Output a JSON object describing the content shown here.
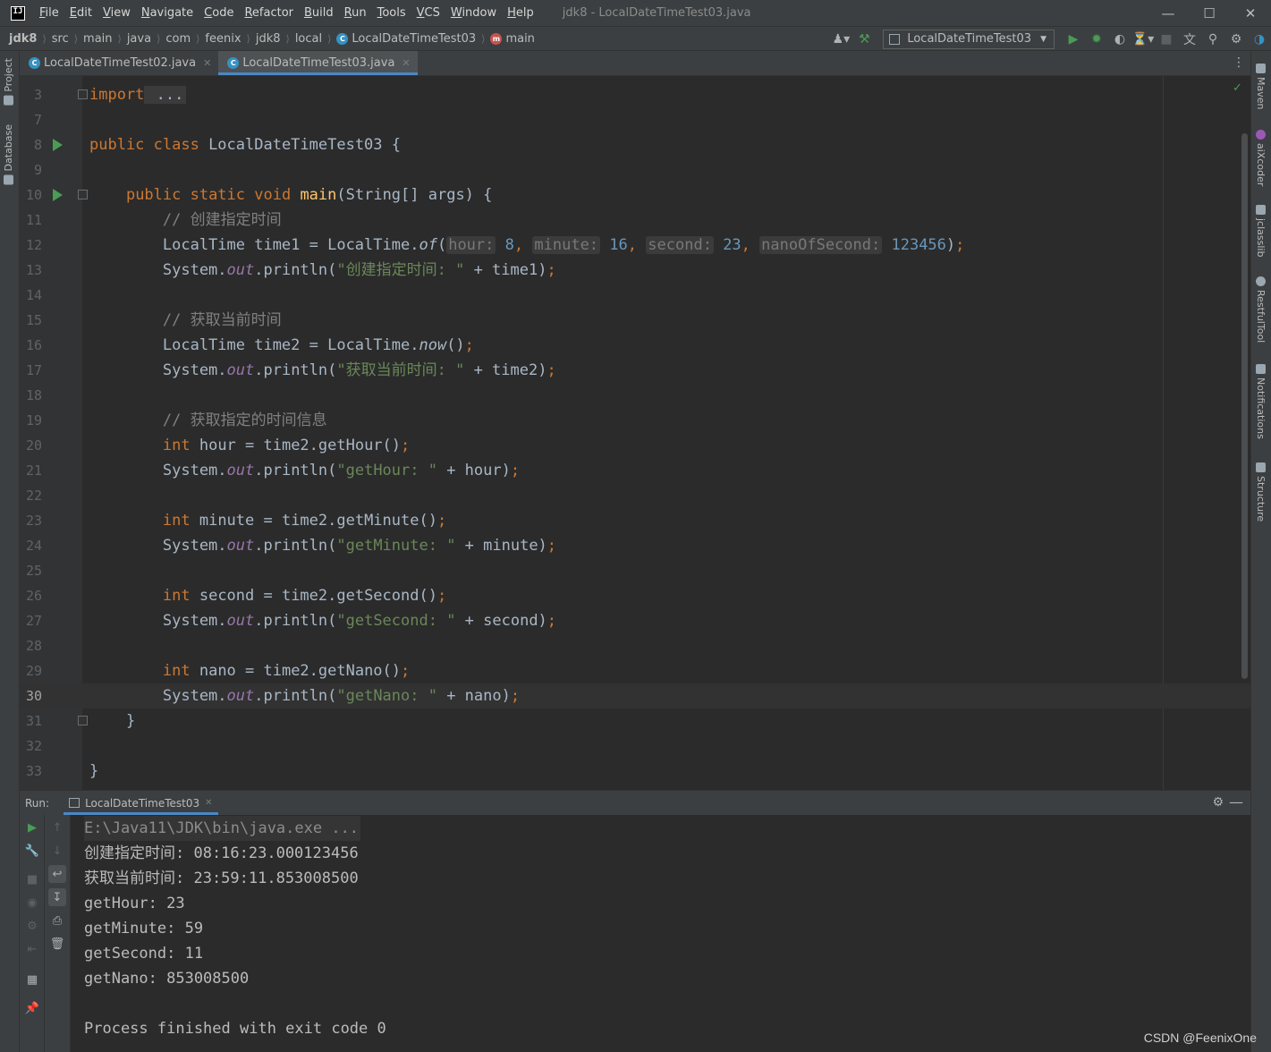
{
  "window": {
    "title": "jdk8 - LocalDateTimeTest03.java",
    "menu": [
      "File",
      "Edit",
      "View",
      "Navigate",
      "Code",
      "Refactor",
      "Build",
      "Run",
      "Tools",
      "VCS",
      "Window",
      "Help"
    ]
  },
  "breadcrumb": [
    "jdk8",
    "src",
    "main",
    "java",
    "com",
    "feenix",
    "jdk8",
    "local",
    "LocalDateTimeTest03",
    "main"
  ],
  "run_config": {
    "label": "LocalDateTimeTest03"
  },
  "tabs": [
    {
      "label": "LocalDateTimeTest02.java",
      "active": false
    },
    {
      "label": "LocalDateTimeTest03.java",
      "active": true
    }
  ],
  "left_tool_windows": [
    "Project",
    "Database"
  ],
  "right_tool_windows": [
    "Maven",
    "aiXcoder",
    "jclasslib",
    "RestfulTool",
    "Notifications",
    "Structure"
  ],
  "editor": {
    "lines": [
      {
        "n": "3",
        "parts": [
          [
            "kw",
            "import"
          ],
          [
            "",
            ""
          ],
          [
            "fold",
            " ..."
          ]
        ],
        "fold": true
      },
      {
        "n": "7",
        "parts": []
      },
      {
        "n": "8",
        "run": true,
        "parts": [
          [
            "kw",
            "public class"
          ],
          [
            "",
            " LocalDateTimeTest03 {"
          ]
        ]
      },
      {
        "n": "9",
        "parts": []
      },
      {
        "n": "10",
        "run": true,
        "fold": true,
        "parts": [
          [
            "",
            "    "
          ],
          [
            "kw",
            "public static void"
          ],
          [
            "",
            " "
          ],
          [
            "fn",
            "main"
          ],
          [
            "",
            "(String[] args) {"
          ]
        ]
      },
      {
        "n": "11",
        "parts": [
          [
            "",
            "        "
          ],
          [
            "cmt",
            "// 创建指定时间"
          ]
        ]
      },
      {
        "n": "12",
        "parts": [
          [
            "",
            "        LocalTime time1 = LocalTime."
          ],
          [
            "it",
            "of"
          ],
          [
            "",
            "("
          ],
          [
            "hint",
            "hour:"
          ],
          [
            "",
            " "
          ],
          [
            "num",
            "8"
          ],
          [
            "kw",
            ","
          ],
          [
            "",
            " "
          ],
          [
            "hint",
            "minute:"
          ],
          [
            "",
            " "
          ],
          [
            "num",
            "16"
          ],
          [
            "kw",
            ","
          ],
          [
            "",
            " "
          ],
          [
            "hint",
            "second:"
          ],
          [
            "",
            " "
          ],
          [
            "num",
            "23"
          ],
          [
            "kw",
            ","
          ],
          [
            "",
            " "
          ],
          [
            "hint",
            "nanoOfSecond:"
          ],
          [
            "",
            " "
          ],
          [
            "num",
            "123456"
          ],
          [
            "",
            ")"
          ],
          [
            "kw",
            ";"
          ]
        ]
      },
      {
        "n": "13",
        "parts": [
          [
            "",
            "        System."
          ],
          [
            "sf",
            "out"
          ],
          [
            "",
            ".println("
          ],
          [
            "str",
            "\"创建指定时间: \""
          ],
          [
            "",
            " + time1)"
          ],
          [
            "kw",
            ";"
          ]
        ]
      },
      {
        "n": "14",
        "parts": []
      },
      {
        "n": "15",
        "parts": [
          [
            "",
            "        "
          ],
          [
            "cmt",
            "// 获取当前时间"
          ]
        ]
      },
      {
        "n": "16",
        "parts": [
          [
            "",
            "        LocalTime time2 = LocalTime."
          ],
          [
            "it",
            "now"
          ],
          [
            "",
            "()"
          ],
          [
            "kw",
            ";"
          ]
        ]
      },
      {
        "n": "17",
        "parts": [
          [
            "",
            "        System."
          ],
          [
            "sf",
            "out"
          ],
          [
            "",
            ".println("
          ],
          [
            "str",
            "\"获取当前时间: \""
          ],
          [
            "",
            " + time2)"
          ],
          [
            "kw",
            ";"
          ]
        ]
      },
      {
        "n": "18",
        "parts": []
      },
      {
        "n": "19",
        "parts": [
          [
            "",
            "        "
          ],
          [
            "cmt",
            "// 获取指定的时间信息"
          ]
        ]
      },
      {
        "n": "20",
        "parts": [
          [
            "",
            "        "
          ],
          [
            "kw",
            "int"
          ],
          [
            "",
            " hour = time2.getHour()"
          ],
          [
            "kw",
            ";"
          ]
        ]
      },
      {
        "n": "21",
        "parts": [
          [
            "",
            "        System."
          ],
          [
            "sf",
            "out"
          ],
          [
            "",
            ".println("
          ],
          [
            "str",
            "\"getHour: \""
          ],
          [
            "",
            " + hour)"
          ],
          [
            "kw",
            ";"
          ]
        ]
      },
      {
        "n": "22",
        "parts": []
      },
      {
        "n": "23",
        "parts": [
          [
            "",
            "        "
          ],
          [
            "kw",
            "int"
          ],
          [
            "",
            " minute = time2.getMinute()"
          ],
          [
            "kw",
            ";"
          ]
        ]
      },
      {
        "n": "24",
        "parts": [
          [
            "",
            "        System."
          ],
          [
            "sf",
            "out"
          ],
          [
            "",
            ".println("
          ],
          [
            "str",
            "\"getMinute: \""
          ],
          [
            "",
            " + minute)"
          ],
          [
            "kw",
            ";"
          ]
        ]
      },
      {
        "n": "25",
        "parts": []
      },
      {
        "n": "26",
        "parts": [
          [
            "",
            "        "
          ],
          [
            "kw",
            "int"
          ],
          [
            "",
            " second = time2.getSecond()"
          ],
          [
            "kw",
            ";"
          ]
        ]
      },
      {
        "n": "27",
        "parts": [
          [
            "",
            "        System."
          ],
          [
            "sf",
            "out"
          ],
          [
            "",
            ".println("
          ],
          [
            "str",
            "\"getSecond: \""
          ],
          [
            "",
            " + second)"
          ],
          [
            "kw",
            ";"
          ]
        ]
      },
      {
        "n": "28",
        "parts": []
      },
      {
        "n": "29",
        "parts": [
          [
            "",
            "        "
          ],
          [
            "kw",
            "int"
          ],
          [
            "",
            " nano = time2.getNano()"
          ],
          [
            "kw",
            ";"
          ]
        ]
      },
      {
        "n": "30",
        "current": true,
        "parts": [
          [
            "",
            "        System."
          ],
          [
            "sf",
            "out"
          ],
          [
            "",
            ".println("
          ],
          [
            "str",
            "\"getNano: \""
          ],
          [
            "",
            " + nano)"
          ],
          [
            "kw",
            ";"
          ]
        ]
      },
      {
        "n": "31",
        "fold": true,
        "parts": [
          [
            "",
            "    }"
          ]
        ]
      },
      {
        "n": "32",
        "parts": []
      },
      {
        "n": "33",
        "parts": [
          [
            "",
            "}"
          ]
        ]
      }
    ]
  },
  "run_panel": {
    "label": "Run:",
    "tab": "LocalDateTimeTest03",
    "output": [
      {
        "text": "E:\\Java11\\JDK\\bin\\java.exe ...",
        "cmd": true
      },
      {
        "text": "创建指定时间: 08:16:23.000123456"
      },
      {
        "text": "获取当前时间: 23:59:11.853008500"
      },
      {
        "text": "getHour: 23"
      },
      {
        "text": "getMinute: 59"
      },
      {
        "text": "getSecond: 11"
      },
      {
        "text": "getNano: 853008500"
      },
      {
        "text": ""
      },
      {
        "text": "Process finished with exit code 0"
      }
    ]
  },
  "watermark": "CSDN @FeenixOne"
}
